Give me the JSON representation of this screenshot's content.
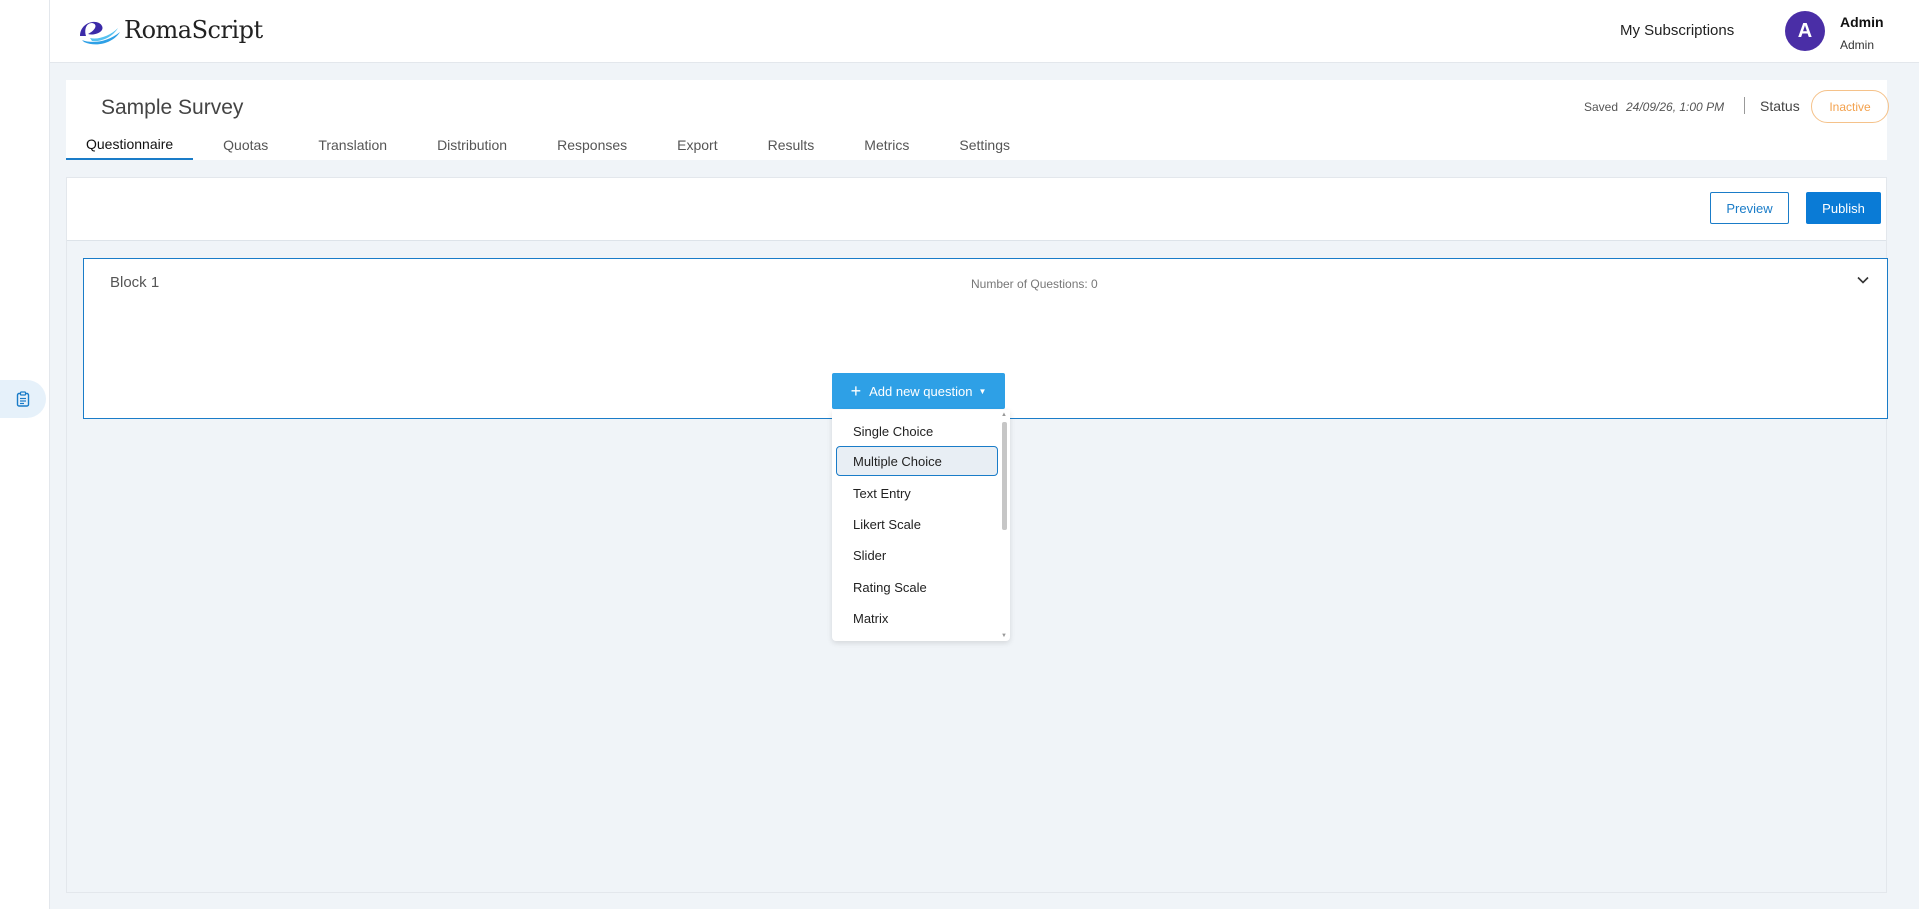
{
  "app": {
    "logo_text": "RomaScript",
    "brand_colors": {
      "primary": "#1a7cc8",
      "publish": "#0a7bd6",
      "avatar": "#4a2ea6",
      "inactive": "#f3a14d"
    }
  },
  "header": {
    "subscriptions_label": "My Subscriptions",
    "avatar_initial": "A",
    "user_name": "Admin",
    "user_role": "Admin"
  },
  "survey": {
    "title": "Sample Survey",
    "saved_label": "Saved",
    "saved_value": "24/09/26, 1:00 PM",
    "status_label": "Status",
    "status_value": "Inactive"
  },
  "tabs": [
    {
      "label": "Questionnaire",
      "active": true
    },
    {
      "label": "Quotas"
    },
    {
      "label": "Translation"
    },
    {
      "label": "Distribution"
    },
    {
      "label": "Responses"
    },
    {
      "label": "Export"
    },
    {
      "label": "Results"
    },
    {
      "label": "Metrics"
    },
    {
      "label": "Settings"
    }
  ],
  "toolbar": {
    "preview_label": "Preview",
    "publish_label": "Publish"
  },
  "block": {
    "title": "Block 1",
    "count_label": "Number of Questions: 0"
  },
  "add_question": {
    "label": "Add new question",
    "options": [
      "Single Choice",
      "Multiple Choice",
      "Text Entry",
      "Likert Scale",
      "Slider",
      "Rating Scale",
      "Matrix"
    ],
    "selected": "Multiple Choice"
  },
  "icons": {
    "left_rail": "clipboard-icon",
    "block_toggle": "chevron-down-icon",
    "add": "plus-icon"
  }
}
